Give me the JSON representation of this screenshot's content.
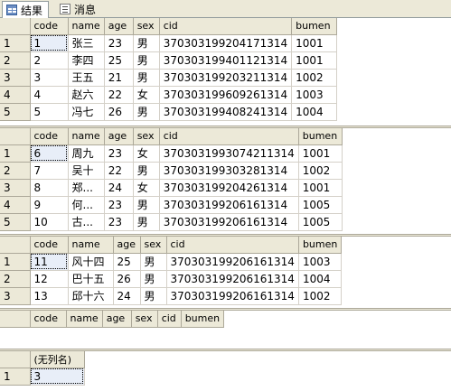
{
  "tabs": [
    {
      "label": "结果",
      "icon": "grid-icon"
    },
    {
      "label": "消息",
      "icon": "message-icon"
    }
  ],
  "grids": [
    {
      "columns": [
        "code",
        "name",
        "age",
        "sex",
        "cid",
        "bumen"
      ],
      "rows": [
        [
          "1",
          "1",
          "张三",
          "23",
          "男",
          "370303199204171314",
          "1001"
        ],
        [
          "2",
          "2",
          "李四",
          "25",
          "男",
          "370303199401121314",
          "1001"
        ],
        [
          "3",
          "3",
          "王五",
          "21",
          "男",
          "370303199203211314",
          "1002"
        ],
        [
          "4",
          "4",
          "赵六",
          "22",
          "女",
          "370303199609261314",
          "1003"
        ],
        [
          "5",
          "5",
          "冯七",
          "26",
          "男",
          "370303199408241314",
          "1004"
        ]
      ]
    },
    {
      "columns": [
        "code",
        "name",
        "age",
        "sex",
        "cid",
        "bumen"
      ],
      "rows": [
        [
          "1",
          "6",
          "周九",
          "23",
          "女",
          "3703031993074211314",
          "1001"
        ],
        [
          "2",
          "7",
          "吴十",
          "22",
          "男",
          "370303199303281314",
          "1002"
        ],
        [
          "3",
          "8",
          "郑...",
          "24",
          "女",
          "370303199204261314",
          "1001"
        ],
        [
          "4",
          "9",
          "何...",
          "23",
          "男",
          "370303199206161314",
          "1005"
        ],
        [
          "5",
          "10",
          "古...",
          "23",
          "男",
          "370303199206161314",
          "1005"
        ]
      ]
    },
    {
      "columns": [
        "code",
        "name",
        "age",
        "sex",
        "cid",
        "bumen"
      ],
      "rows": [
        [
          "1",
          "11",
          "风十四",
          "25",
          "男",
          "370303199206161314",
          "1003"
        ],
        [
          "2",
          "12",
          "巴十五",
          "26",
          "男",
          "370303199206161314",
          "1004"
        ],
        [
          "3",
          "13",
          "邱十六",
          "24",
          "男",
          "370303199206161314",
          "1002"
        ]
      ]
    },
    {
      "columns": [
        "code",
        "name",
        "age",
        "sex",
        "cid",
        "bumen"
      ],
      "rows": []
    },
    {
      "columns": [
        "(无列名)"
      ],
      "rows": [
        [
          "1",
          "3"
        ]
      ]
    }
  ]
}
